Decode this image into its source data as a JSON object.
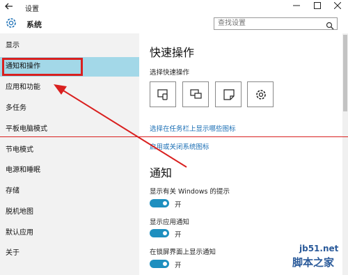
{
  "window": {
    "title": "设置",
    "back_icon": "arrow-left-icon",
    "minimize_icon": "minimize-icon",
    "maximize_icon": "maximize-icon",
    "close_icon": "close-icon"
  },
  "header": {
    "title": "系统",
    "icon": "gear-icon",
    "search_placeholder": "查找设置",
    "search_icon": "search-icon"
  },
  "sidebar": {
    "items": [
      {
        "label": "显示"
      },
      {
        "label": "通知和操作",
        "selected": true
      },
      {
        "label": "应用和功能"
      },
      {
        "label": "多任务"
      },
      {
        "label": "平板电脑模式"
      },
      {
        "label": "节电模式"
      },
      {
        "label": "电源和睡眠"
      },
      {
        "label": "存储"
      },
      {
        "label": "脱机地图"
      },
      {
        "label": "默认应用"
      },
      {
        "label": "关于"
      }
    ]
  },
  "main": {
    "quick_actions": {
      "heading": "快速操作",
      "subheading": "选择快速操作",
      "tiles": [
        {
          "icon": "tablet-mode-icon"
        },
        {
          "icon": "project-display-icon"
        },
        {
          "icon": "note-icon"
        },
        {
          "icon": "settings-gear-icon"
        }
      ],
      "link_taskbar_icons": "选择在任务栏上显示哪些图标",
      "link_system_icons": "启用或关闭系统图标"
    },
    "notifications": {
      "heading": "通知",
      "options": [
        {
          "label": "显示有关 Windows 的提示",
          "state": "开",
          "on": true
        },
        {
          "label": "显示应用通知",
          "state": "开",
          "on": true
        },
        {
          "label": "在锁屏界面上显示通知",
          "state": "开",
          "on": true
        }
      ]
    }
  },
  "colors": {
    "accent": "#1e8fbf",
    "selection": "#a3d8e8",
    "annotation_red": "#d9201f",
    "link": "#1b6fb5"
  },
  "watermark": {
    "site": "jb51.net",
    "name": "脚本之家"
  }
}
